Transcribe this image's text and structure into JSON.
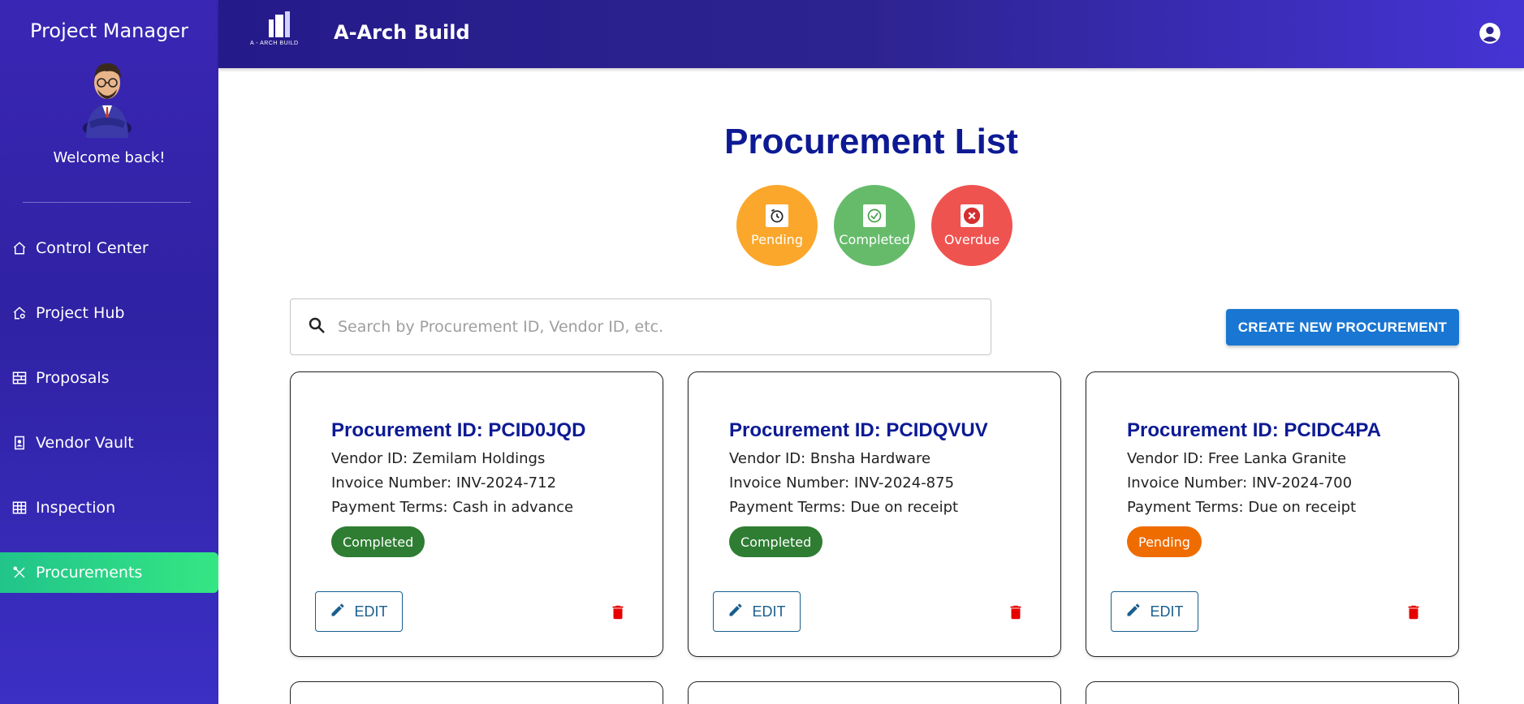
{
  "sidebar": {
    "title": "Project Manager",
    "welcome": "Welcome back!",
    "items": [
      {
        "label": "Control Center",
        "icon": "home-icon"
      },
      {
        "label": "Project Hub",
        "icon": "home-gear-icon"
      },
      {
        "label": "Proposals",
        "icon": "brick-wall-icon"
      },
      {
        "label": "Vendor Vault",
        "icon": "contact-book-icon"
      },
      {
        "label": "Inspection",
        "icon": "table-icon"
      },
      {
        "label": "Procurements",
        "icon": "tools-icon",
        "active": true
      }
    ],
    "active_color": "#2ecc71"
  },
  "header": {
    "logo_text": "A - ARCH BUILD",
    "brand": "A-Arch Build",
    "account_icon": "account-circle-icon"
  },
  "main": {
    "title": "Procurement List",
    "status_filters": [
      {
        "label": "Pending",
        "icon": "clock-icon",
        "color": "#fba72b"
      },
      {
        "label": "Completed",
        "icon": "check-circle-icon",
        "color": "#66bb6a"
      },
      {
        "label": "Overdue",
        "icon": "x-circle-icon",
        "color": "#ef5350"
      }
    ],
    "search": {
      "placeholder": "Search by Procurement ID, Vendor ID, etc.",
      "value": ""
    },
    "create_button": "CREATE NEW PROCUREMENT"
  },
  "cards": [
    {
      "id_label": "Procurement ID: PCID0JQD",
      "vendor": "Vendor ID: Zemilam Holdings",
      "invoice": "Invoice Number: INV-2024-712",
      "terms": "Payment Terms: Cash in advance",
      "status": "Completed",
      "edit": "EDIT"
    },
    {
      "id_label": "Procurement ID: PCIDQVUV",
      "vendor": "Vendor ID: Bnsha Hardware",
      "invoice": "Invoice Number: INV-2024-875",
      "terms": "Payment Terms: Due on receipt",
      "status": "Completed",
      "edit": "EDIT"
    },
    {
      "id_label": "Procurement ID: PCIDC4PA",
      "vendor": "Vendor ID: Free Lanka Granite",
      "invoice": "Invoice Number: INV-2024-700",
      "terms": "Payment Terms: Due on receipt",
      "status": "Pending",
      "edit": "EDIT"
    }
  ]
}
